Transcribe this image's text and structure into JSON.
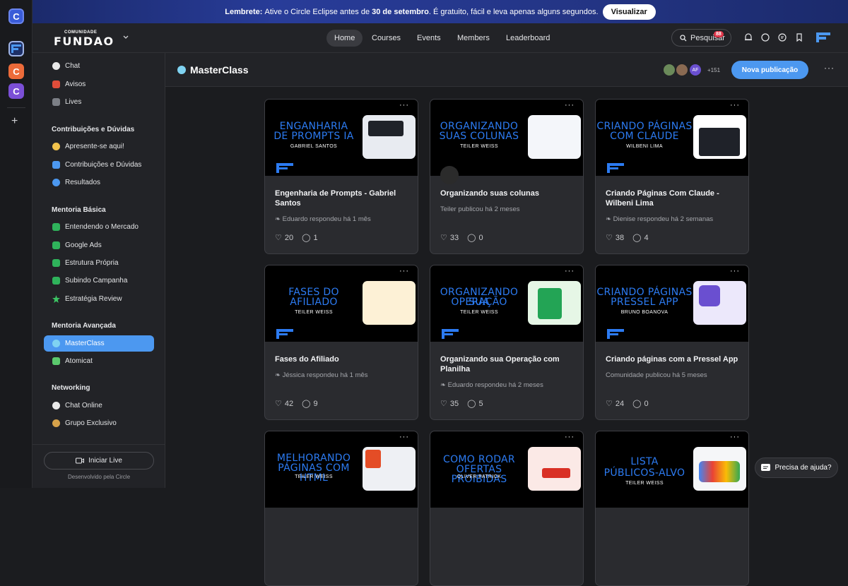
{
  "rail": {
    "apps": [
      {
        "letter": "C",
        "color": "#3a5cd8"
      },
      {
        "letter": "",
        "color": "#1d2f66"
      },
      {
        "letter": "C",
        "color": "#ec6b3a"
      },
      {
        "letter": "C",
        "color": "#7b4fd6"
      }
    ],
    "add": "+"
  },
  "banner": {
    "prefix": "Lembrete:",
    "text_before": "Ative o Circle Eclipse antes de",
    "date": "30 de setembro",
    "text_after": ". É gratuito, fácil e leva apenas alguns segundos.",
    "button": "Visualizar"
  },
  "topbar": {
    "logo_top": "COMUNIDADE",
    "logo_main": "FUNDAO",
    "tabs": [
      "Home",
      "Courses",
      "Events",
      "Members",
      "Leaderboard"
    ],
    "search": "Pesquisar",
    "notifications": "88"
  },
  "sidebar": {
    "top": [
      {
        "label": "Chat",
        "color": "#e9e9e9"
      },
      {
        "label": "Avisos",
        "color": "#e04d3a"
      },
      {
        "label": "Lives",
        "color": "#7c7f86"
      }
    ],
    "groups": [
      {
        "title": "Contribuições e Dúvidas",
        "items": [
          {
            "label": "Apresente-se aqui!",
            "color": "#f2c34c"
          },
          {
            "label": "Contribuições e Dúvidas",
            "color": "#4c98f0"
          },
          {
            "label": "Resultados",
            "color": "#4c98f0"
          }
        ]
      },
      {
        "title": "Mentoria Básica",
        "items": [
          {
            "label": "Entendendo o Mercado",
            "color": "#2fb35b"
          },
          {
            "label": "Google Ads",
            "color": "#2fb35b"
          },
          {
            "label": "Estrutura Própria",
            "color": "#2fb35b"
          },
          {
            "label": "Subindo Campanha",
            "color": "#2fb35b"
          },
          {
            "label": "Estratégia Review",
            "color": "#3cc463"
          }
        ]
      },
      {
        "title": "Mentoria Avançada",
        "items": [
          {
            "label": "MasterClass",
            "color": "#7fd3f2"
          },
          {
            "label": "Atomicat",
            "color": "#5bc96d"
          }
        ]
      },
      {
        "title": "Networking",
        "items": [
          {
            "label": "Chat Online",
            "color": "#e9e9e9"
          },
          {
            "label": "Grupo Exclusivo",
            "color": "#d6a24a"
          }
        ]
      }
    ],
    "live_button": "Iniciar Live",
    "powered": "Desenvolvido pela Circle"
  },
  "header": {
    "title": "MasterClass",
    "avatar_initials": "AF",
    "member_count": "+151",
    "new_post": "Nova publicação"
  },
  "cards": [
    {
      "thumb1": "ENGANHARIA",
      "thumb1b": "DE PROMPTS IA",
      "thumb2": "GABRIEL SANTOS",
      "title": "Engenharia de Prompts - Gabriel Santos",
      "meta": "Eduardo respondeu há 1 mês",
      "likes": "20",
      "comments": "1",
      "shot": "#e8ebf1"
    },
    {
      "thumb1": "ORGANIZANDO",
      "thumb1b": "SUAS COLUNAS",
      "thumb2": "TEILER WEISS",
      "title": "Organizando suas colunas",
      "meta": "Teiler publicou há 2 meses",
      "likes": "33",
      "comments": "0",
      "shot": "#f4f6fa"
    },
    {
      "thumb1": "CRIANDO PÁGINAS",
      "thumb1b": "COM CLAUDE",
      "thumb2": "WILBENI LIMA",
      "title": "Criando Páginas Com Claude - Wilbeni Lima",
      "meta": "Dienise respondeu há 2 semanas",
      "likes": "38",
      "comments": "4",
      "shot": "#ffffff"
    },
    {
      "thumb1": "FASES DO",
      "thumb1b": "AFILIADO",
      "thumb2": "TEILER WEISS",
      "title": "Fases do Afiliado",
      "meta": "Jéssica respondeu há 1 mês",
      "likes": "42",
      "comments": "9",
      "shot": "#fdf1d6"
    },
    {
      "thumb1": "ORGANIZANDO SUA",
      "thumb1b": "OPERAÇÃO",
      "thumb2": "TEILER WEISS",
      "title": "Organizando sua Operação com Planilha",
      "meta": "Eduardo respondeu há 2 meses",
      "likes": "35",
      "comments": "5",
      "shot": "#e6f6e6"
    },
    {
      "thumb1": "CRIANDO PÁGINAS",
      "thumb1b": "PRESSEL APP",
      "thumb2": "BRUNO BOANOVA",
      "title": "Criando páginas com a Pressel App",
      "meta": "Comunidade publicou há 5 meses",
      "likes": "24",
      "comments": "0",
      "shot": "#ece8fb"
    },
    {
      "thumb1": "MELHORANDO",
      "thumb1b": "PÁGINAS COM HTML",
      "thumb2": "TEILER WEISS",
      "title": "",
      "meta": "",
      "likes": "",
      "comments": "",
      "shot": "#eef0f4"
    },
    {
      "thumb1": "COMO RODAR",
      "thumb1b": "OFERTAS PROIBIDAS",
      "thumb2": "OLIVER PATRICK",
      "title": "",
      "meta": "",
      "likes": "",
      "comments": "",
      "shot": "#fbe9e6"
    },
    {
      "thumb1": "LISTA",
      "thumb1b": "PÚBLICOS-ALVO",
      "thumb2": "TEILER WEISS",
      "title": "",
      "meta": "",
      "likes": "",
      "comments": "",
      "shot": "#f5f6f8"
    }
  ],
  "help": "Precisa de ajuda?"
}
